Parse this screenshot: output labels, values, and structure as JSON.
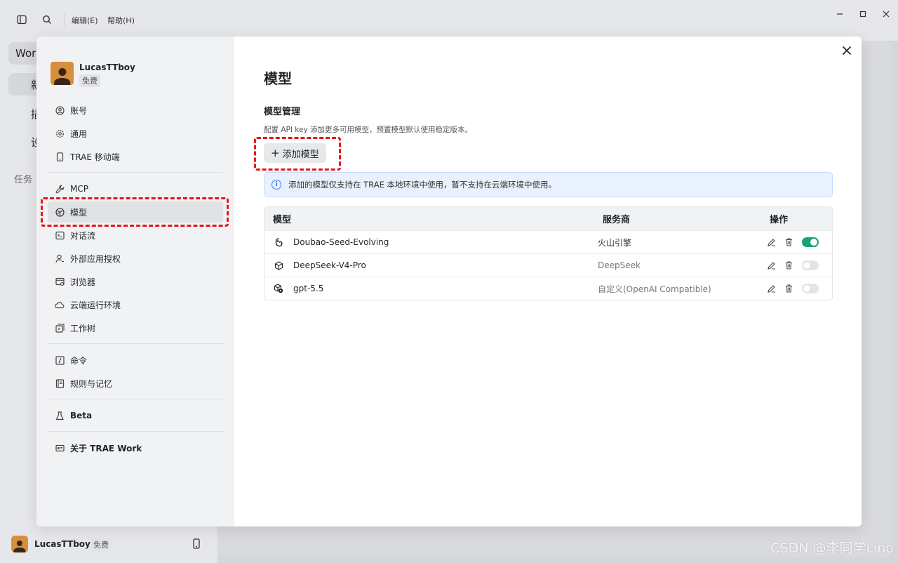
{
  "app": {
    "menu": [
      "编辑(E)",
      "帮助(H)"
    ],
    "bg_sidebar": {
      "workspace_label": "Work",
      "items": [
        "新",
        "插",
        "设"
      ],
      "section": "任务"
    },
    "bottom_user": {
      "name": "LucasTTboy",
      "badge": "免费"
    },
    "watermark": "CSDN @李同学Lino"
  },
  "settings": {
    "profile": {
      "name": "LucasTTboy",
      "badge": "免费"
    },
    "nav": [
      {
        "label": "账号",
        "icon": "user-circle-icon"
      },
      {
        "label": "通用",
        "icon": "gear-icon"
      },
      {
        "label": "TRAE 移动端",
        "icon": "mobile-icon"
      },
      {
        "label": "MCP",
        "icon": "wrench-icon"
      },
      {
        "label": "模型",
        "icon": "model-icon"
      },
      {
        "label": "对话流",
        "icon": "terminal-icon"
      },
      {
        "label": "外部应用授权",
        "icon": "user-auth-icon"
      },
      {
        "label": "浏览器",
        "icon": "browser-icon"
      },
      {
        "label": "云端运行环境",
        "icon": "cloud-icon"
      },
      {
        "label": "工作树",
        "icon": "tree-icon"
      },
      {
        "label": "命令",
        "icon": "command-icon"
      },
      {
        "label": "规则与记忆",
        "icon": "book-icon"
      },
      {
        "label": "Beta",
        "icon": "flask-icon"
      },
      {
        "label": "关于 TRAE Work",
        "icon": "info-card-icon"
      }
    ],
    "active_nav": "模型",
    "page_title": "模型",
    "section_title": "模型管理",
    "section_desc": "配置 API key 添加更多可用模型，预置模型默认使用稳定版本。",
    "add_button": "添加模型",
    "info_text": "添加的模型仅支持在 TRAE 本地环境中使用，暂不支持在云端环境中使用。",
    "table": {
      "headers": [
        "模型",
        "服务商",
        "操作"
      ],
      "rows": [
        {
          "name": "Doubao-Seed-Evolving",
          "provider": "火山引擎",
          "enabled": true,
          "icon": "doubao-icon"
        },
        {
          "name": "DeepSeek-V4-Pro",
          "provider": "DeepSeek",
          "enabled": false,
          "icon": "cube-icon"
        },
        {
          "name": "gpt-5.5",
          "provider": "自定义(OpenAI Compatible)",
          "enabled": false,
          "icon": "cube-settings-icon"
        }
      ]
    },
    "highlight_color": "#e8141a",
    "toggle_on_color": "#1aa36f"
  }
}
